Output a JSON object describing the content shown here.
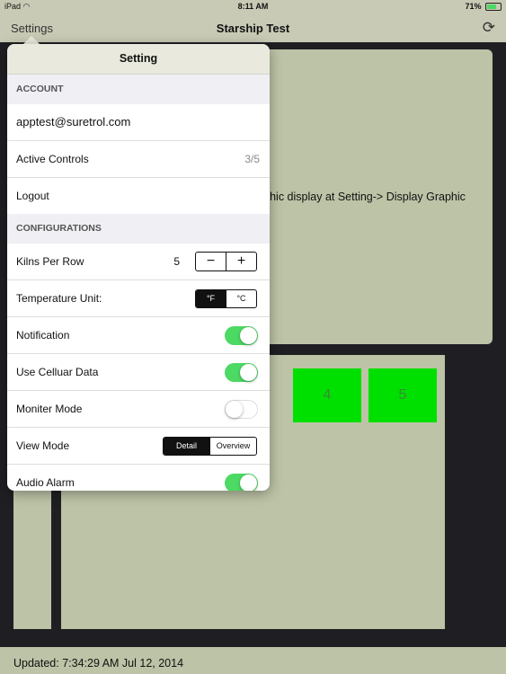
{
  "status_bar": {
    "device": "iPad",
    "time": "8:11 AM",
    "battery": "71%",
    "battery_level": 0.71
  },
  "nav": {
    "back_label": "Settings",
    "title": "Starship Test",
    "refresh_icon": "refresh-icon"
  },
  "graphic_panel": {
    "message": "Turn on graphic display at Setting-> Display Graphic"
  },
  "kilns": [
    {
      "label": "4"
    },
    {
      "label": "5"
    }
  ],
  "footer": {
    "updated": "Updated: 7:34:29 AM Jul 12, 2014"
  },
  "popover": {
    "title": "Setting",
    "account": {
      "header": "ACCOUNT",
      "email": "apptest@suretrol.com",
      "active_controls_label": "Active Controls",
      "active_controls_value": "3/5",
      "logout_label": "Logout"
    },
    "configurations": {
      "header": "CONFIGURATIONS",
      "kilns_per_row_label": "Kilns Per Row",
      "kilns_per_row_value": "5",
      "stepper_minus": "−",
      "stepper_plus": "+",
      "temperature_label": "Temperature Unit:",
      "temperature_options": [
        "°F",
        "°C"
      ],
      "temperature_selected": "°F",
      "notification_label": "Notification",
      "notification_on": true,
      "cellular_label": "Use Celluar Data",
      "cellular_on": true,
      "moniter_label": "Moniter Mode",
      "moniter_on": false,
      "view_mode_label": "View Mode",
      "view_mode_options": [
        "Detail",
        "Overview"
      ],
      "view_mode_selected": "Detail",
      "audio_alarm_label": "Audio Alarm",
      "audio_alarm_on": true
    }
  },
  "colors": {
    "toggle_on": "#4cd964",
    "kiln_active": "#00e000",
    "panel_bg": "#bcc3a6",
    "chrome_bg": "#c8cab5"
  }
}
